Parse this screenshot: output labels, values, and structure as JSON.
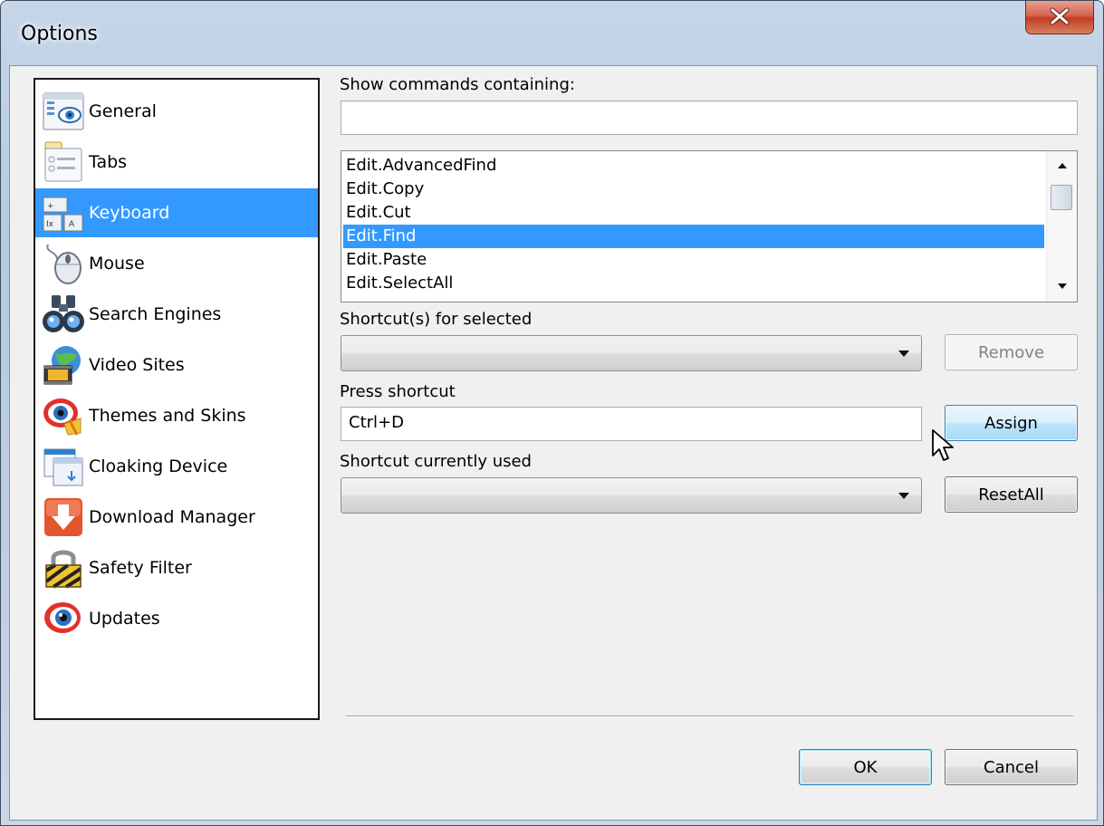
{
  "window": {
    "title": "Options",
    "close_glyph": "X"
  },
  "sidebar": {
    "items": [
      {
        "label": "General",
        "icon": "general-icon",
        "selected": false
      },
      {
        "label": "Tabs",
        "icon": "tabs-icon",
        "selected": false
      },
      {
        "label": "Keyboard",
        "icon": "keyboard-icon",
        "selected": true
      },
      {
        "label": "Mouse",
        "icon": "mouse-icon",
        "selected": false
      },
      {
        "label": "Search Engines",
        "icon": "binoculars-icon",
        "selected": false
      },
      {
        "label": "Video Sites",
        "icon": "video-sites-icon",
        "selected": false
      },
      {
        "label": "Themes and Skins",
        "icon": "themes-icon",
        "selected": false
      },
      {
        "label": "Cloaking Device",
        "icon": "cloaking-icon",
        "selected": false
      },
      {
        "label": "Download Manager",
        "icon": "download-icon",
        "selected": false
      },
      {
        "label": "Safety Filter",
        "icon": "lock-icon",
        "selected": false
      },
      {
        "label": "Updates",
        "icon": "updates-icon",
        "selected": false
      }
    ]
  },
  "keyboard": {
    "search_label": "Show commands containing:",
    "search_value": "",
    "commands": [
      "Edit.AdvancedFind",
      "Edit.Copy",
      "Edit.Cut",
      "Edit.Find",
      "Edit.Paste",
      "Edit.SelectAll"
    ],
    "selected_command": "Edit.Find",
    "shortcuts_label": "Shortcut(s) for selected",
    "shortcuts_value": "",
    "remove_label": "Remove",
    "press_label": "Press shortcut",
    "press_value": "Ctrl+D",
    "assign_label": "Assign",
    "used_label": "Shortcut currently used",
    "used_value": "",
    "reset_label": "ResetAll"
  },
  "footer": {
    "ok_label": "OK",
    "cancel_label": "Cancel"
  },
  "colors": {
    "selection": "#3399ff",
    "frame": "#b6c9df",
    "close_button": "#c33d23"
  }
}
